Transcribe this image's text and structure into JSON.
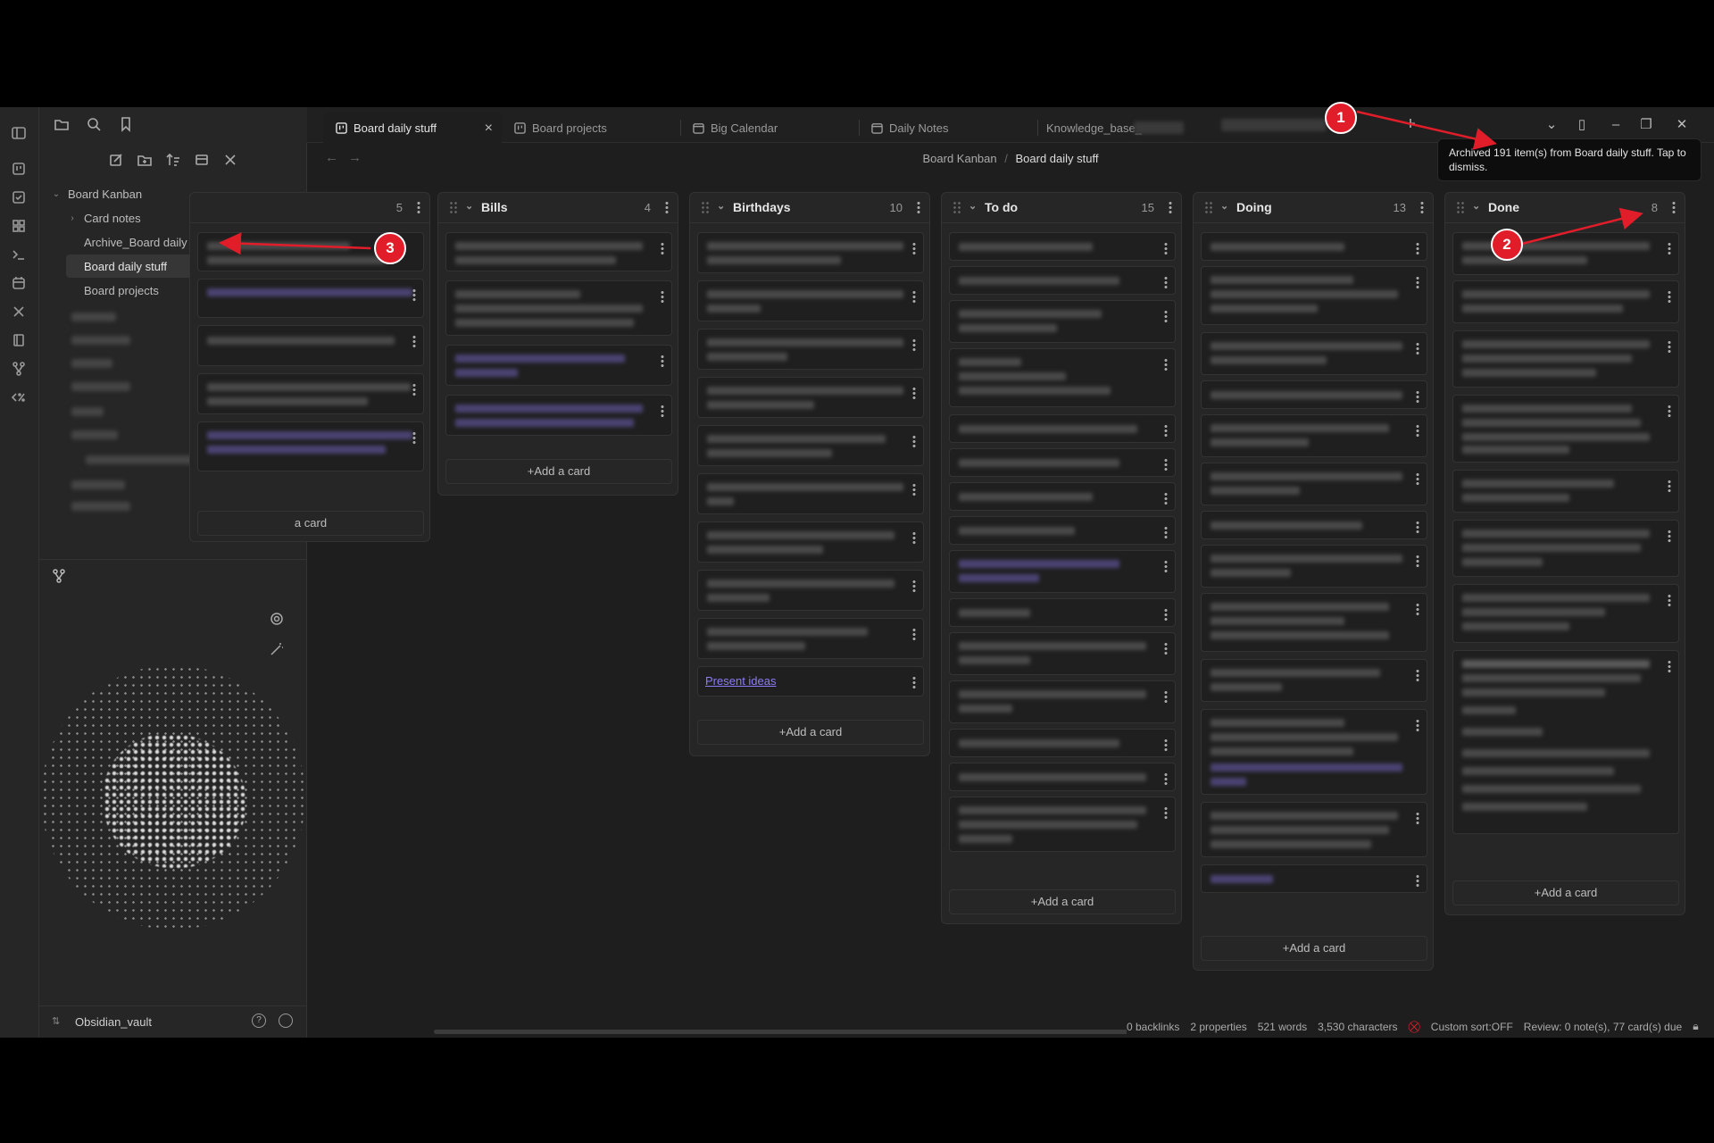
{
  "tabs": [
    {
      "label": "Board daily stuff",
      "active": true
    },
    {
      "label": "Board projects"
    },
    {
      "label": "Big Calendar"
    },
    {
      "label": "Daily Notes"
    },
    {
      "label": "Knowledge_base_"
    }
  ],
  "breadcrumb": {
    "parent": "Board Kanban",
    "separator": "/",
    "current": "Board daily stuff"
  },
  "tree": {
    "root": "Board Kanban",
    "items": [
      "Card notes",
      "Archive_Board daily stuff",
      "Board daily stuff",
      "Board projects"
    ]
  },
  "vault": {
    "name": "Obsidian_vault"
  },
  "lanes": [
    {
      "title": "",
      "count": "5",
      "add_label": "a card"
    },
    {
      "title": "Bills",
      "count": "4",
      "add_label": "+Add a card"
    },
    {
      "title": "Birthdays",
      "count": "10",
      "add_label": "+Add a card",
      "link_card": "Present ideas"
    },
    {
      "title": "To do",
      "count": "15",
      "add_label": "+Add a card"
    },
    {
      "title": "Doing",
      "count": "13",
      "add_label": "+Add a card"
    },
    {
      "title": "Done",
      "count": "8",
      "add_label": "+Add a card"
    }
  ],
  "notice": {
    "text": "Archived 191 item(s) from Board daily stuff. Tap to dismiss."
  },
  "status": {
    "backlinks": "0 backlinks",
    "properties": "2 properties",
    "words": "521 words",
    "characters": "3,530 characters",
    "custom_sort": "Custom sort:OFF",
    "review": "Review: 0 note(s), 77 card(s) due"
  },
  "annotations": [
    "1",
    "2",
    "3"
  ],
  "colors": {
    "accent": "#8b7cf6",
    "marker": "#e11d2a",
    "background": "#1e1e1e"
  }
}
